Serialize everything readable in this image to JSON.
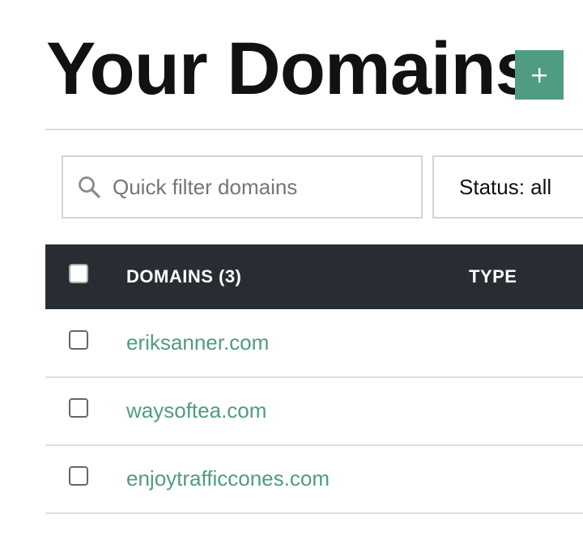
{
  "page": {
    "title": "Your Domains",
    "add_button_icon": "plus-icon"
  },
  "filter": {
    "placeholder": "Quick filter domains",
    "icon": "search-icon"
  },
  "status_filter": {
    "label": "Status: all"
  },
  "table": {
    "columns": [
      "DOMAINS (3)",
      "TYPE"
    ],
    "rows": [
      {
        "domain": "eriksanner.com"
      },
      {
        "domain": "waysoftea.com"
      },
      {
        "domain": "enjoytrafficcones.com"
      }
    ]
  },
  "colors": {
    "accent": "#4f9c82",
    "header_bg": "#282d34"
  }
}
